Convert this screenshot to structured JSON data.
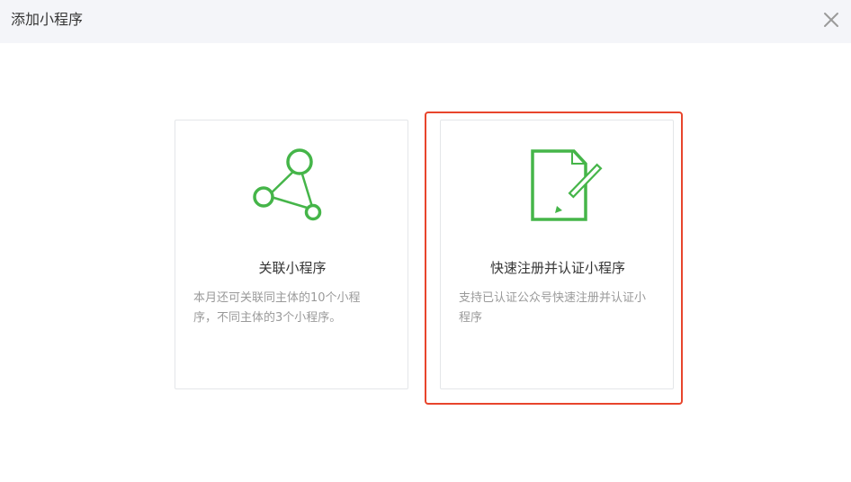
{
  "dialog": {
    "title": "添加小程序",
    "close_icon": "close-icon"
  },
  "cards": {
    "associate": {
      "icon": "share-nodes-icon",
      "title": "关联小程序",
      "description": "本月还可关联同主体的10个小程序，不同主体的3个小程序。"
    },
    "register": {
      "icon": "document-edit-icon",
      "title": "快速注册并认证小程序",
      "description": "支持已认证公众号快速注册并认证小程序"
    }
  },
  "colors": {
    "accent_green": "#45b549",
    "highlight_red": "#e8452c",
    "header_bg": "#f4f5f9",
    "text_primary": "#353535",
    "text_secondary": "#9a9a9a"
  }
}
